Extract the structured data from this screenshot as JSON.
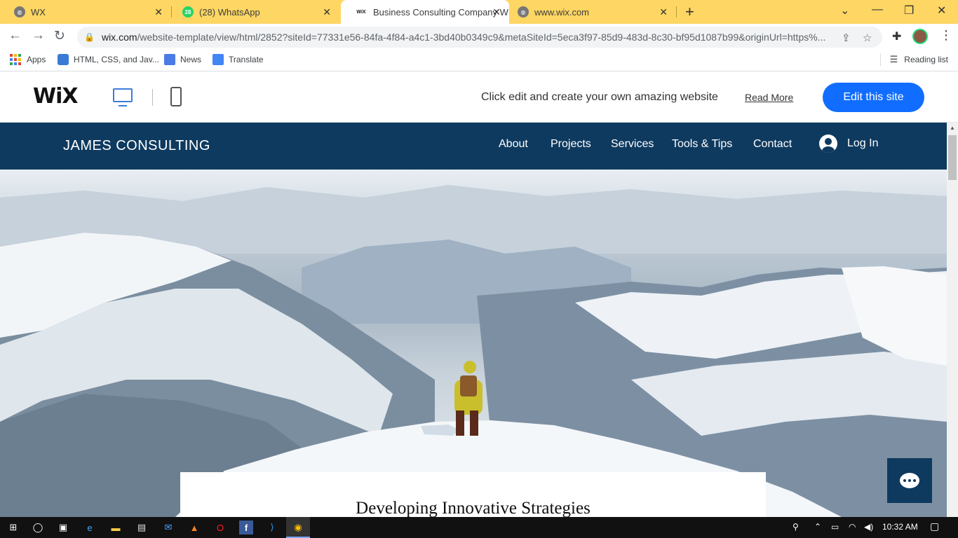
{
  "browser": {
    "tabs": [
      {
        "title": "WX",
        "favicon": "globe-icon",
        "active": false
      },
      {
        "title": "(28) WhatsApp",
        "favicon": "whatsapp-icon",
        "badge": "28",
        "active": false
      },
      {
        "title": "Business Consulting Company W",
        "favicon": "wix-icon",
        "favicon_text": "WiX",
        "active": true
      },
      {
        "title": "www.wix.com",
        "favicon": "globe-icon",
        "active": false
      }
    ],
    "url_host": "wix.com",
    "url_path": "/website-template/view/html/2852?siteId=77331e56-84fa-4f84-a4c1-3bd40b0349c9&metaSiteId=5eca3f97-85d9-483d-8c30-bf95d1087b99&originUrl=https%...",
    "bookmarks": [
      {
        "label": "Apps",
        "icon": "apps-grid-icon"
      },
      {
        "label": "HTML, CSS, and Jav...",
        "icon": "bookmark-site-icon"
      },
      {
        "label": "News",
        "icon": "news-icon"
      },
      {
        "label": "Translate",
        "icon": "translate-icon"
      }
    ],
    "reading_list": "Reading list"
  },
  "wix_bar": {
    "logo": "WiX",
    "message": "Click edit and create your own amazing website",
    "read_more": "Read More",
    "edit_button": "Edit this site",
    "accent": "#116dff"
  },
  "site": {
    "brand": "JAMES CONSULTING",
    "nav": [
      "About",
      "Projects",
      "Services",
      "Tools & Tips",
      "Contact"
    ],
    "login": "Log In",
    "header_color": "#0f3a5f",
    "hero_heading": "Developing Innovative Strategies"
  },
  "taskbar": {
    "time": "10:32 AM",
    "apps": [
      "start-icon",
      "cortana-icon",
      "task-view-icon",
      "edge-icon",
      "file-explorer-icon",
      "store-icon",
      "mail-icon",
      "vlc-icon",
      "opera-icon",
      "facebook-icon",
      "vscode-icon",
      "chrome-icon"
    ]
  }
}
